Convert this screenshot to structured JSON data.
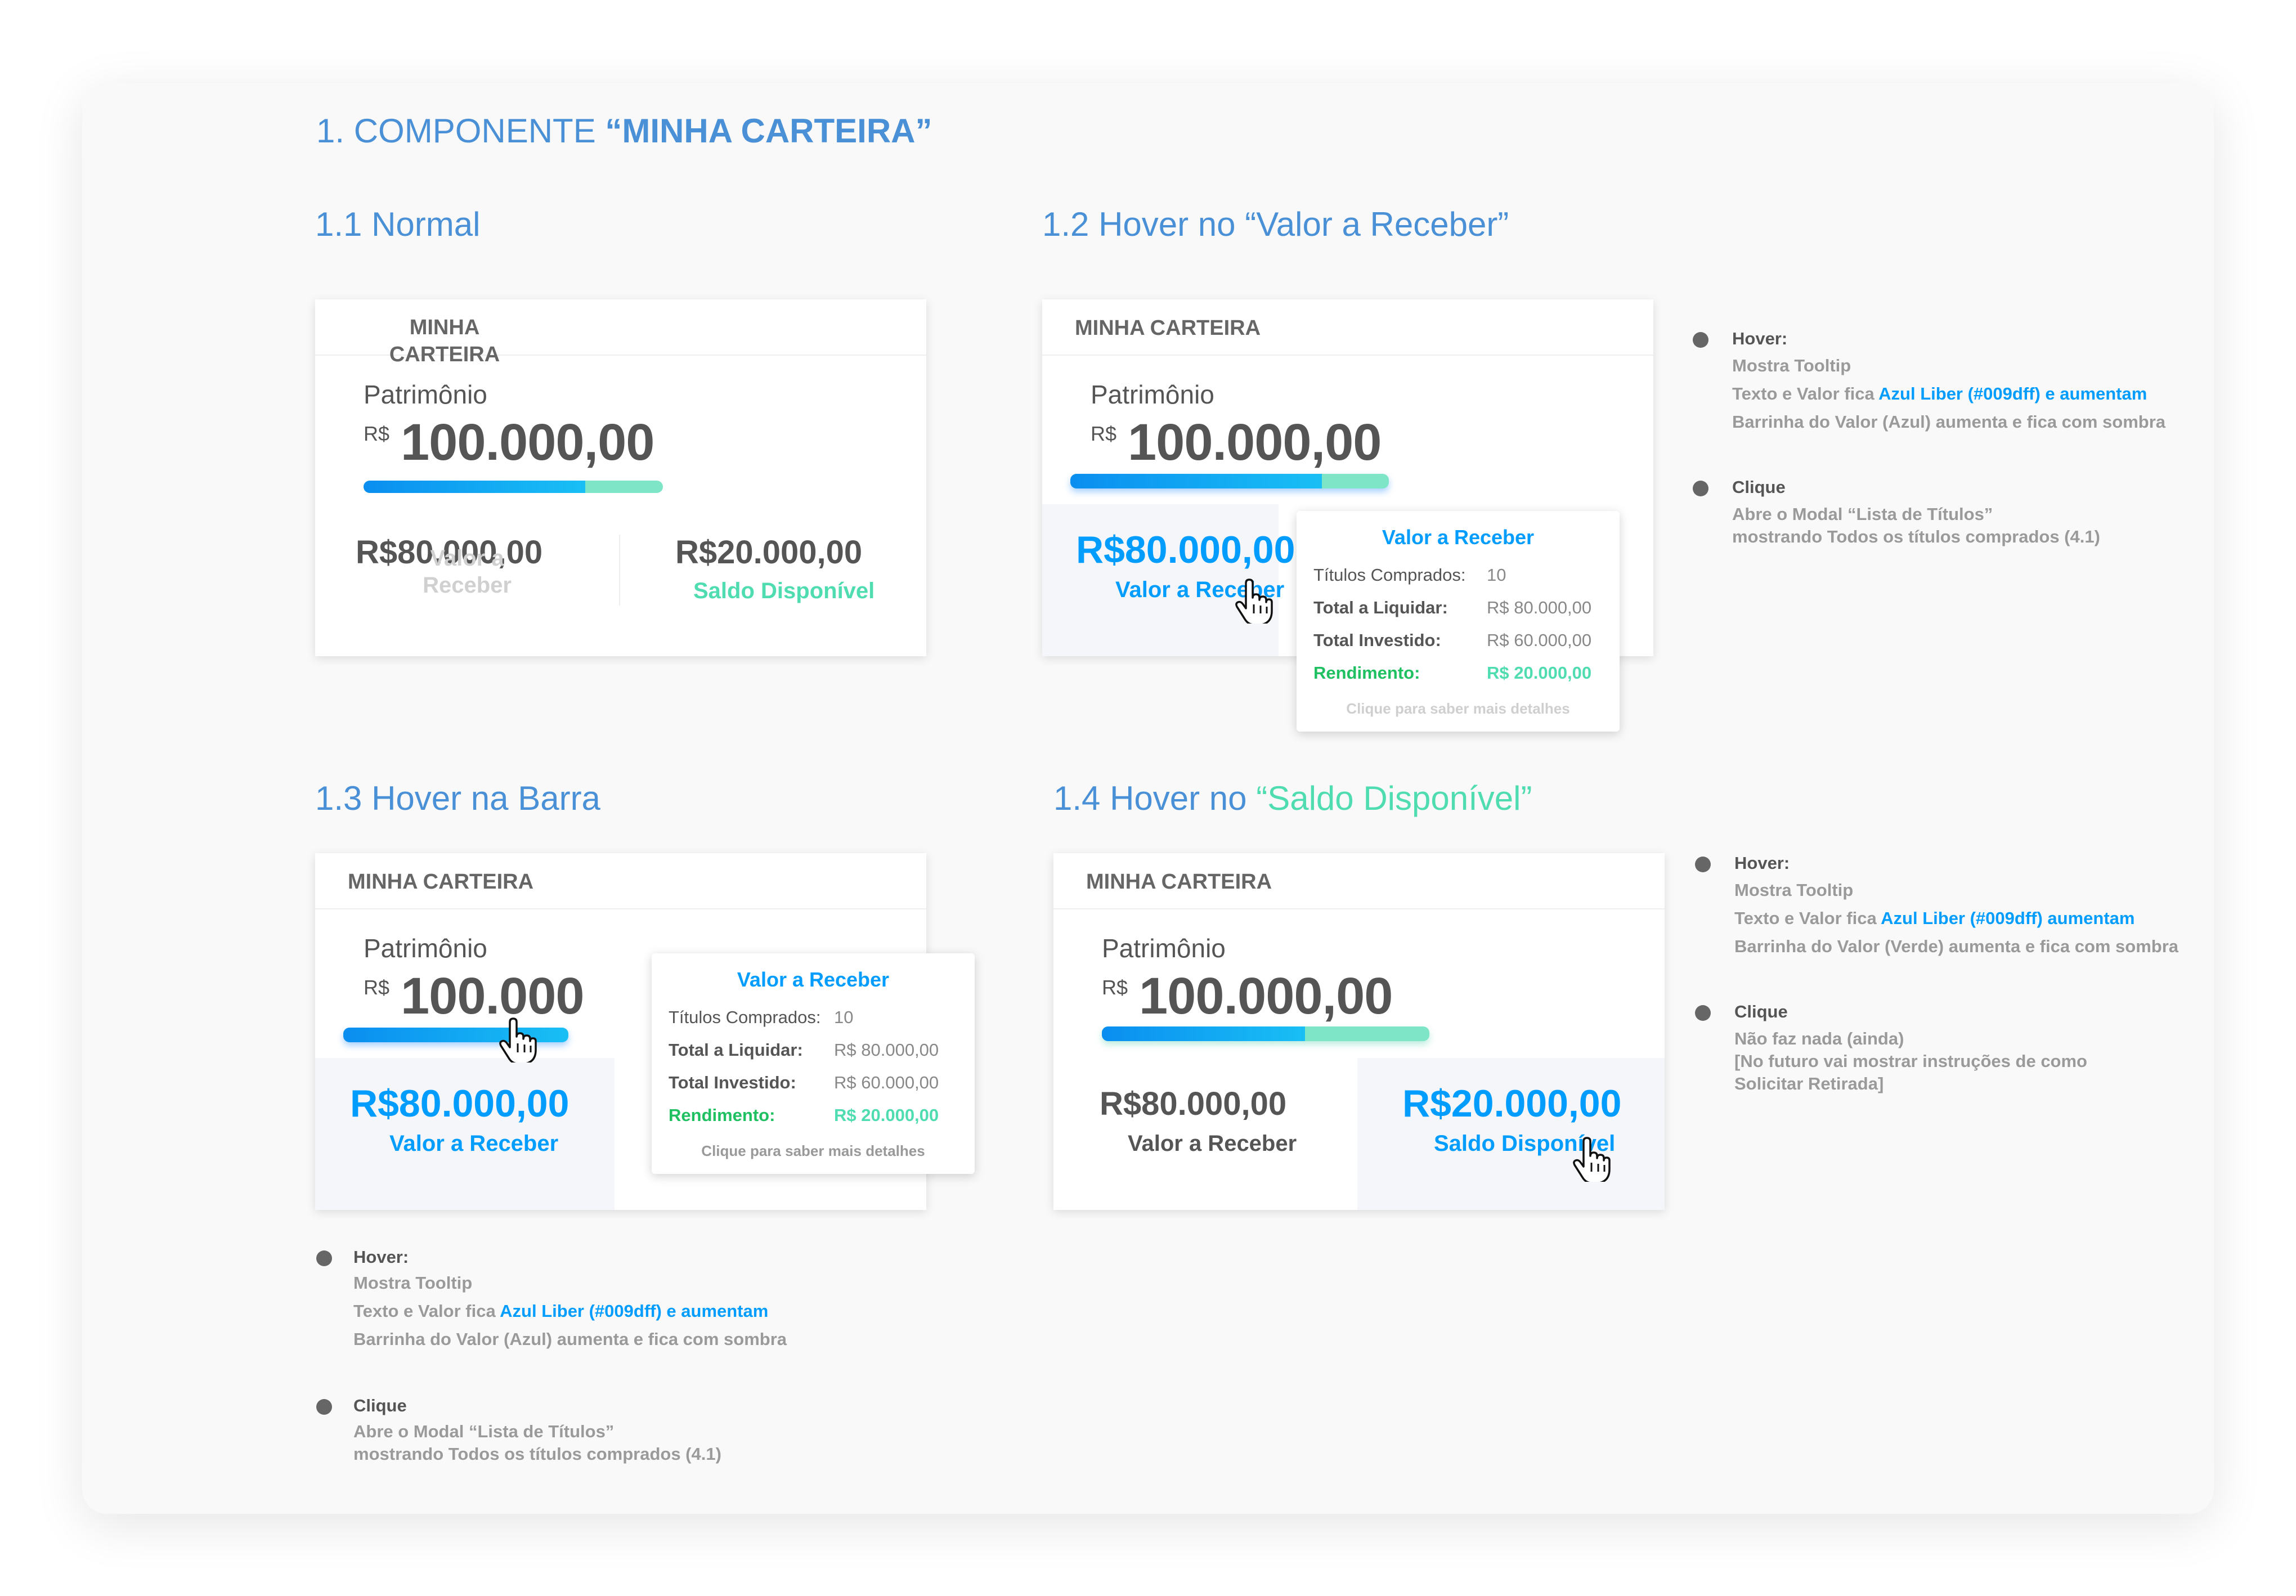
{
  "page_title": {
    "prefix": "1. COMPONENTE ",
    "bold": "“MINHA CARTEIRA”"
  },
  "sections": {
    "normal": "1.1 Normal",
    "hover_valor": {
      "prefix": "1.2 Hover no ",
      "accent": "“Valor a Receber”"
    },
    "hover_barra": "1.3 Hover na Barra",
    "hover_saldo": {
      "prefix": "1.4 Hover no ",
      "accent": "“Saldo Disponível”"
    }
  },
  "card": {
    "title": "MINHA CARTEIRA",
    "patrimonio_label": "Patrimônio",
    "currency": "R$",
    "patrimonio_value": "100.000,00",
    "patrimonio_value_cut": "100.000",
    "receber_value": "R$80.000,00",
    "receber_label": "Valor a Receber",
    "saldo_value": "R$20.000,00",
    "saldo_label": "Saldo Disponível",
    "bar_blue_fraction": 0.8
  },
  "tooltip": {
    "title": "Valor a Receber",
    "rows": [
      {
        "label": "Títulos Comprados:",
        "value": "10"
      },
      {
        "label": "Total a Liquidar:",
        "value": "R$ 80.000,00"
      },
      {
        "label": "Total Investido:",
        "value": "R$ 60.000,00"
      },
      {
        "label": "Rendimento:",
        "value": "R$ 20.000,00"
      }
    ],
    "footer": "Clique para saber mais detalhes"
  },
  "notes": {
    "blue_bar": {
      "hover_head": "Hover:",
      "hover_lines": [
        "Mostra Tooltip",
        "Texto e Valor fica ",
        "Azul Liber (#009dff) e aumentam",
        "Barrinha do Valor (Azul) aumenta e fica com sombra"
      ],
      "click_head": "Clique",
      "click_lines": [
        "Abre o Modal “Lista de Títulos”",
        "mostrando Todos os títulos comprados (4.1)"
      ]
    },
    "saldo": {
      "hover_head": "Hover:",
      "hover_lines": [
        "Mostra Tooltip",
        "Texto e Valor fica ",
        "Azul Liber (#009dff) aumentam",
        "Barrinha do Valor (Verde) aumenta e fica com sombra"
      ],
      "click_head": "Clique",
      "click_lines": [
        "Não faz nada (ainda)",
        "[No futuro vai mostrar instruções de como",
        "Solicitar Retirada]"
      ]
    }
  },
  "colors": {
    "heading_blue": "#4a90d6",
    "azul_liber": "#009dff",
    "green": "#4fdcb0",
    "rendimento_green": "#1ec061"
  },
  "icons": [
    "hand-pointer-icon",
    "bullet-icon"
  ]
}
